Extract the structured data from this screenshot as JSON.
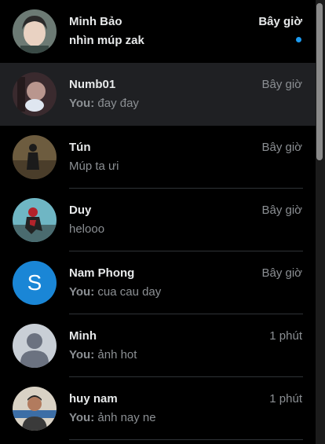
{
  "conversations": [
    {
      "name": "Minh Bảo",
      "time": "Bây giờ",
      "preview": "nhìn múp zak",
      "you_prefix": "",
      "unread": true,
      "avatar": "photo-face-icon"
    },
    {
      "name": "Numb01",
      "time": "Bây giờ",
      "preview": "đay đay",
      "you_prefix": "You:",
      "unread": false,
      "active": true,
      "avatar": "photo-blurred-icon"
    },
    {
      "name": "Tún",
      "time": "Bây giờ",
      "preview": "Múp ta ưi",
      "you_prefix": "",
      "unread": false,
      "avatar": "photo-silhouette-icon"
    },
    {
      "name": "Duy",
      "time": "Bây giờ",
      "preview": "helooo",
      "you_prefix": "",
      "unread": false,
      "avatar": "photo-spiderman-icon"
    },
    {
      "name": "Nam Phong",
      "time": "Bây giờ",
      "preview": "cua cau day",
      "you_prefix": "You:",
      "unread": false,
      "avatar_letter": "S"
    },
    {
      "name": "Minh",
      "time": "1 phút",
      "preview": "ảnh hot",
      "you_prefix": "You:",
      "unread": false,
      "avatar": "default-avatar-icon"
    },
    {
      "name": "huy nam",
      "time": "1 phút",
      "preview": "ảnh nay ne",
      "you_prefix": "You:",
      "unread": false,
      "avatar": "photo-man-icon"
    }
  ],
  "colors": {
    "background": "#000000",
    "active_row": "#1f2023",
    "unread_dot": "#1d9bf0",
    "letter_avatar": "#1a86d6"
  }
}
